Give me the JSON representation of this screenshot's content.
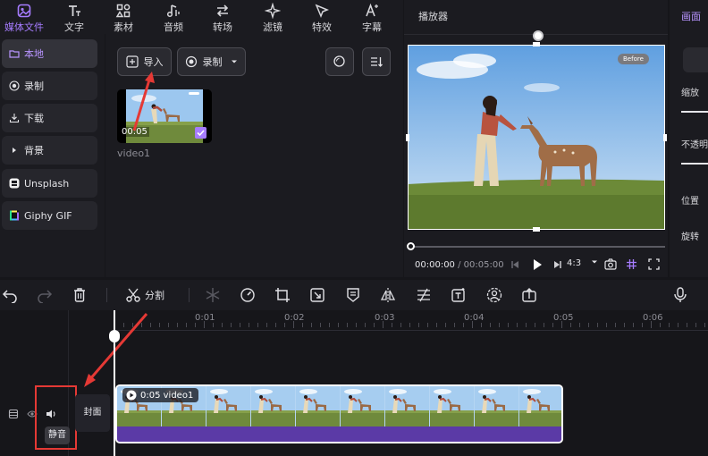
{
  "top_tabs": [
    {
      "label": "媒体文件",
      "icon": "media-icon",
      "active": true
    },
    {
      "label": "文字",
      "icon": "text-icon"
    },
    {
      "label": "素材",
      "icon": "elements-icon"
    },
    {
      "label": "音频",
      "icon": "audio-icon"
    },
    {
      "label": "转场",
      "icon": "transition-icon"
    },
    {
      "label": "滤镜",
      "icon": "filter-icon"
    },
    {
      "label": "特效",
      "icon": "effects-icon"
    },
    {
      "label": "字幕",
      "icon": "captions-icon"
    }
  ],
  "left_nav": [
    {
      "label": "本地",
      "icon": "folder-icon",
      "active": true
    },
    {
      "label": "录制",
      "icon": "record-icon"
    },
    {
      "label": "下载",
      "icon": "download-icon"
    },
    {
      "label": "背景",
      "icon": "caret-right-icon"
    },
    {
      "label": "Unsplash",
      "icon": "unsplash-icon"
    },
    {
      "label": "Giphy GIF",
      "icon": "giphy-icon"
    }
  ],
  "media": {
    "import_label": "导入",
    "record_label": "录制",
    "clip_duration": "00:05",
    "clip_name": "video1"
  },
  "player": {
    "title": "播放器",
    "before_badge": "Before",
    "time_current": "00:00:00",
    "time_separator": "/",
    "time_total": "00:05:00",
    "aspect": "4:3"
  },
  "right_panel": {
    "tab": "画面",
    "scale_label": "缩放",
    "opacity_label": "不透明",
    "position_label": "位置",
    "rotate_label": "旋转"
  },
  "timeline": {
    "split_label": "分割",
    "ruler": [
      "0:01",
      "0:02",
      "0:03",
      "0:04",
      "0:05",
      "0:06"
    ],
    "clip_label": "0:05 video1",
    "cover_label": "封面",
    "mute_tooltip": "静音"
  },
  "colors": {
    "accent": "#a67cff",
    "highlight_box": "#e53935",
    "audio_bar": "#5b3aa6"
  }
}
